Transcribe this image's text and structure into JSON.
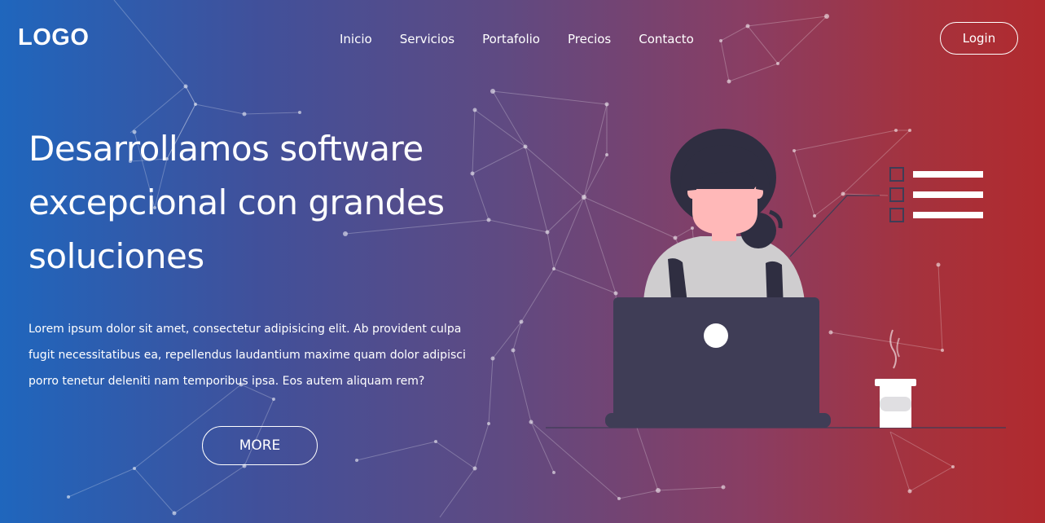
{
  "header": {
    "logo": "LOGO",
    "nav": [
      {
        "label": "Inicio"
      },
      {
        "label": "Servicios"
      },
      {
        "label": "Portafolio"
      },
      {
        "label": "Precios"
      },
      {
        "label": "Contacto"
      }
    ],
    "login_label": "Login"
  },
  "hero": {
    "headline": "Desarrollamos software excepcional con grandes soluciones",
    "paragraph": "Lorem ipsum dolor sit amet, consectetur adipisicing elit. Ab provident culpa fugit necessitatibus ea, repellendus laudantium maxime quam dolor adipisci porro tenetur deleniti nam temporibus ipsa. Eos autem aliquam rem?",
    "cta_label": "MORE"
  },
  "colors": {
    "gradient_left": "#1f66bd",
    "gradient_right": "#b12a2e",
    "laptop": "#3f3d56",
    "hair": "#2f2e41",
    "skin": "#ffb8b8",
    "shirt": "#cfcdcf"
  },
  "icons": [
    "person-at-laptop-illustration",
    "checklist-icon",
    "coffee-cup-icon",
    "network-background"
  ]
}
